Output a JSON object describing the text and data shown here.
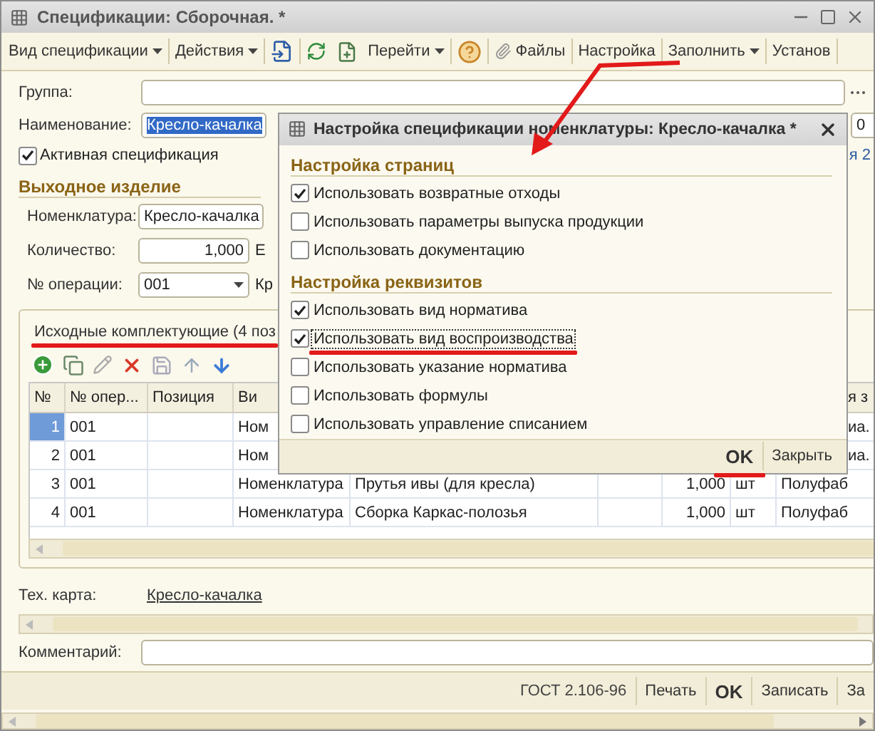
{
  "window": {
    "title": "Спецификации: Сборочная. *"
  },
  "toolbar": [
    {
      "kind": "menu",
      "label": "Вид спецификации"
    },
    {
      "kind": "menu",
      "label": "Действия"
    },
    {
      "kind": "icons"
    },
    {
      "kind": "menu",
      "label": "Перейти"
    },
    {
      "kind": "help"
    },
    {
      "kind": "attachment",
      "label": "Файлы"
    },
    {
      "kind": "button",
      "label": "Настройка"
    },
    {
      "kind": "menu",
      "label": "Заполнить"
    },
    {
      "kind": "button",
      "label": "Установ"
    }
  ],
  "group": {
    "label": "Группа:"
  },
  "name": {
    "label": "Наименование:",
    "value": "Кресло-качалка",
    "selected": true,
    "fragment": "0"
  },
  "active": {
    "label": "Активная спецификация",
    "checked": true,
    "link_fragment": "я 2"
  },
  "output": {
    "title": "Выходное изделие",
    "nomenclature": {
      "label": "Номенклатура:",
      "value": "Кресло-качалка"
    },
    "quantity": {
      "label": "Количество:",
      "value": "1,000",
      "fragment": "Е"
    },
    "operation": {
      "label": "№ операции:",
      "value": "001",
      "fragment": "Кр"
    }
  },
  "tab": {
    "label": "Исходные комплектующие (4 поз",
    "underlined": true
  },
  "table": {
    "columns": [
      "№",
      "№ опер...",
      "Позиция",
      "Ви"
    ],
    "last_column_fragment": "я з",
    "rows": [
      {
        "n": "1",
        "operation": "001",
        "kind": "Ном",
        "tail": "иа.",
        "selected": true
      },
      {
        "n": "2",
        "operation": "001",
        "kind": "Ном",
        "tail": "иа.",
        "selected": false
      },
      {
        "n": "3",
        "operation": "001",
        "kind": "Номенклатура",
        "item": "Прутья ивы (для кресла)",
        "quantity": "1,000",
        "unit": "шт",
        "tail": "Полуфаб",
        "selected": false
      },
      {
        "n": "4",
        "operation": "001",
        "kind": "Номенклатура",
        "item": "Сборка Каркас-полозья",
        "quantity": "1,000",
        "unit": "шт",
        "tail": "Полуфаб",
        "selected": false
      }
    ]
  },
  "tech_card": {
    "label": "Тех. карта:",
    "link": "Кресло-качалка"
  },
  "comment": {
    "label": "Комментарий:"
  },
  "footer": [
    {
      "kind": "text",
      "label": "ГОСТ 2.106-96"
    },
    {
      "kind": "button",
      "label": "Печать",
      "default": false
    },
    {
      "kind": "button",
      "label": "OK",
      "default": true
    },
    {
      "kind": "button",
      "label": "Записать",
      "default": false
    },
    {
      "kind": "button",
      "label": "За",
      "default": false
    }
  ],
  "dialog": {
    "title": "Настройка спецификации номенклатуры: Кресло-качалка *",
    "sections": [
      {
        "title": "Настройка страниц",
        "options": [
          {
            "label": "Использовать возвратные отходы",
            "checked": true,
            "focused": false,
            "underlined": false
          },
          {
            "label": "Использовать параметры выпуска продукции",
            "checked": false,
            "focused": false,
            "underlined": false
          },
          {
            "label": "Использовать документацию",
            "checked": false,
            "focused": false,
            "underlined": false
          }
        ]
      },
      {
        "title": "Настройка реквизитов",
        "options": [
          {
            "label": "Использовать вид норматива",
            "checked": true,
            "focused": false,
            "underlined": false
          },
          {
            "label": "Использовать вид воспроизводства",
            "checked": true,
            "focused": true,
            "underlined": true
          },
          {
            "label": "Использовать указание норматива",
            "checked": false,
            "focused": false,
            "underlined": false
          },
          {
            "label": "Использовать формулы",
            "checked": false,
            "focused": false,
            "underlined": false
          },
          {
            "label": "Использовать управление списанием",
            "checked": false,
            "focused": false,
            "underlined": false
          }
        ]
      }
    ],
    "buttons": [
      {
        "label": "OK",
        "default": true,
        "underlined": true
      },
      {
        "label": "Закрыть",
        "default": false,
        "underlined": false
      }
    ]
  }
}
